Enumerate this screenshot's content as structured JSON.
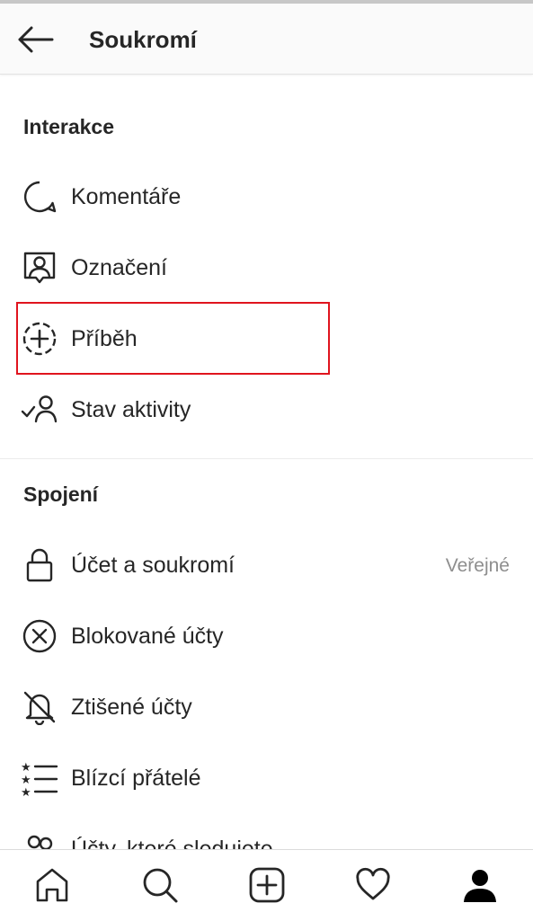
{
  "header": {
    "title": "Soukromí",
    "back_icon": "arrow-left-icon"
  },
  "sections": {
    "interakce": {
      "title": "Interakce",
      "items": [
        {
          "label": "Komentáře",
          "icon": "comment-icon"
        },
        {
          "label": "Označení",
          "icon": "tag-person-icon"
        },
        {
          "label": "Příběh",
          "icon": "story-add-icon",
          "highlighted": true
        },
        {
          "label": "Stav aktivity",
          "icon": "activity-status-icon"
        }
      ]
    },
    "spojeni": {
      "title": "Spojení",
      "items": [
        {
          "label": "Účet a soukromí",
          "icon": "lock-icon",
          "value": "Veřejné"
        },
        {
          "label": "Blokované účty",
          "icon": "blocked-icon"
        },
        {
          "label": "Ztišené účty",
          "icon": "muted-bell-icon"
        },
        {
          "label": "Blízcí přátelé",
          "icon": "close-friends-icon"
        },
        {
          "label": "Účty, které sledujete",
          "icon": "following-icon"
        }
      ]
    }
  },
  "tabbar": [
    {
      "icon": "home-icon"
    },
    {
      "icon": "search-icon"
    },
    {
      "icon": "new-post-icon"
    },
    {
      "icon": "heart-icon"
    },
    {
      "icon": "profile-icon"
    }
  ],
  "colors": {
    "text": "#262626",
    "secondary_text": "#8e8e8e",
    "highlight_border": "#e0141e"
  }
}
